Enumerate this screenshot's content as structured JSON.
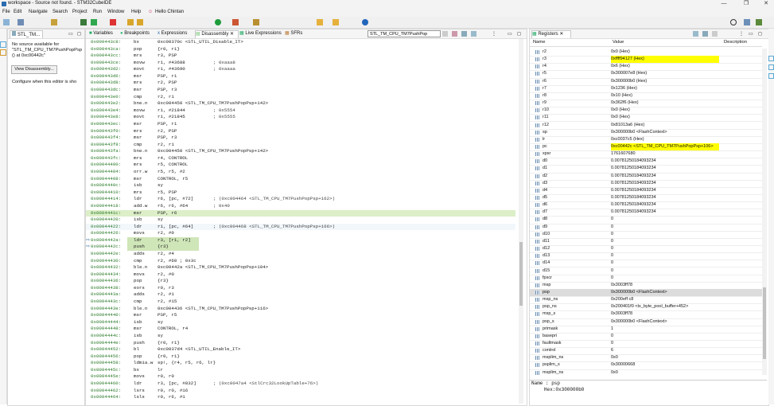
{
  "window": {
    "title": "workspace - Source not found. - STM32CubeIDE",
    "controls": [
      "—",
      "❐",
      "✕"
    ]
  },
  "menu": [
    "File",
    "Edit",
    "Navigate",
    "Search",
    "Project",
    "Run",
    "Window",
    "Help"
  ],
  "greeting": "Hello Chintan",
  "editor": {
    "tab": "STL_TM...",
    "message": [
      "No source available for",
      "\"STL_TM_CPU_TM7PushPopPsp",
      "() at 0xc00442c\""
    ],
    "button": "View Disassembly...",
    "hint": "Configure when this editor is sho"
  },
  "center_tabs": [
    "Variables",
    "Breakpoints",
    "Expressions",
    "Disassembly",
    "Live Expressions",
    "SFRs"
  ],
  "address_field": "STL_TM_CPU_TM7PushPop",
  "disassembly": [
    [
      "0x000443c8:",
      "bx",
      "0xc00370c <STL_UTIL_Disable_IT>",
      ""
    ],
    [
      "0x000443ca:",
      "pop",
      "{r0, r1}",
      ""
    ],
    [
      "0x000443cc:",
      "mrs",
      "r3, PSP",
      ""
    ],
    [
      "0x000443ce:",
      "movw",
      "r1, #43688",
      "; 0xaaa8"
    ],
    [
      "0x000443d2:",
      "movt",
      "r1, #43690",
      "; 0xaaaa"
    ],
    [
      "0x000443d6:",
      "msr",
      "PSP, r1",
      ""
    ],
    [
      "0x000443d8:",
      "mrs",
      "r2, PSP",
      ""
    ],
    [
      "0x000443dc:",
      "msr",
      "PSP, r3",
      ""
    ],
    [
      "0x000443e0:",
      "cmp",
      "r2, r1",
      ""
    ],
    [
      "0x000443e2:",
      "bne.n",
      "0xc004450 <STL_TM_CPU_TM7PushPopPsp+142>",
      ""
    ],
    [
      "0x000443e4:",
      "movw",
      "r1, #21844",
      "; 0x5554"
    ],
    [
      "0x000443e8:",
      "movt",
      "r1, #21845",
      "; 0x5555"
    ],
    [
      "0x000443ec:",
      "msr",
      "PSP, r1",
      ""
    ],
    [
      "0x000443f0:",
      "mrs",
      "r2, PSP",
      ""
    ],
    [
      "0x000443f4:",
      "msr",
      "PSP, r3",
      ""
    ],
    [
      "0x000443f8:",
      "cmp",
      "r2, r1",
      ""
    ],
    [
      "0x000443fa:",
      "bne.n",
      "0xc004450 <STL_TM_CPU_TM7PushPopPsp+142>",
      ""
    ],
    [
      "0x000443fc:",
      "mrs",
      "r4, CONTROL",
      ""
    ],
    [
      "0x00044400:",
      "mrs",
      "r5, CONTROL",
      ""
    ],
    [
      "0x00044404:",
      "orr.w",
      "r5, r5, #2",
      ""
    ],
    [
      "0x00044408:",
      "msr",
      "CONTROL, r5",
      ""
    ],
    [
      "0x0004440c:",
      "isb",
      "sy",
      ""
    ],
    [
      "0x00044410:",
      "mrs",
      "r5, PSP",
      ""
    ],
    [
      "0x00044414:",
      "ldr",
      "r6, [pc, #72]",
      "; (0xc004464 <STL_TM_CPU_TM7PushPopPsp+162>)"
    ],
    [
      "0x00044418:",
      "add.w",
      "r6, r6, #64",
      "; 0x40"
    ],
    [
      "0x0004441c:",
      "msr",
      "PSP, r6",
      ""
    ],
    [
      "0x00044420:",
      "isb",
      "sy",
      ""
    ],
    [
      "0x00044422:",
      "ldr",
      "r1, [pc, #64]",
      "; (0xc004468 <STL_TM_CPU_TM7PushPopPsp+166>)"
    ],
    [
      "0x00044426:",
      "movs",
      "r2, #0",
      ""
    ],
    [
      "0x0004442a:",
      "ldr",
      "r3, [r1, r2]",
      ""
    ],
    [
      "0x0004442c:",
      "push",
      "{r3}",
      ""
    ],
    [
      "0x0004442e:",
      "adds",
      "r2, #4",
      ""
    ],
    [
      "0x00044430:",
      "cmp",
      "r2, #60 ; 0x3c",
      ""
    ],
    [
      "0x00044432:",
      "ble.n",
      "0xc00442a <STL_TM_CPU_TM7PushPopPsp+104>",
      ""
    ],
    [
      "0x00044434:",
      "movs",
      "r2, #0",
      ""
    ],
    [
      "0x00044436:",
      "pop",
      "{r3}",
      ""
    ],
    [
      "0x00044438:",
      "eors",
      "r0, r3",
      ""
    ],
    [
      "0x0004443a:",
      "adds",
      "r2, #1",
      ""
    ],
    [
      "0x0004443c:",
      "cmp",
      "r2, #15",
      ""
    ],
    [
      "0x0004443e:",
      "ble.n",
      "0xc004436 <STL_TM_CPU_TM7PushPopPsp+116>",
      ""
    ],
    [
      "0x00044440:",
      "msr",
      "PSP, r5",
      ""
    ],
    [
      "0x00044444:",
      "isb",
      "sy",
      ""
    ],
    [
      "0x00044448:",
      "msr",
      "CONTROL, r4",
      ""
    ],
    [
      "0x0004444c:",
      "isb",
      "sy",
      ""
    ],
    [
      "0x0004444e:",
      "push",
      "{r0, r1}",
      ""
    ],
    [
      "0x00044452:",
      "bl",
      "0xc0037d4 <STL_UTIL_Enable_IT>",
      ""
    ],
    [
      "0x00044456:",
      "pop",
      "{r0, r1}",
      ""
    ],
    [
      "0x00044458:",
      "ldmia.w",
      "sp!, {r4, r5, r6, lr}",
      ""
    ],
    [
      "0x0004445c:",
      "bx",
      "lr",
      ""
    ],
    [
      "0x0004445e:",
      "movs",
      "r0, r0",
      ""
    ],
    [
      "0x00044460:",
      "ldr",
      "r3, [pc, #832]",
      "; (0xc0047a4 <StlCrc32LookUpTable+76>)"
    ],
    [
      "0x00044462:",
      "lsrs",
      "r0, r0, #16",
      ""
    ],
    [
      "0x00044464:",
      "lsls",
      "r0, r6, #1",
      ""
    ]
  ],
  "registers_tab": "Registers",
  "registers_columns": [
    "Name",
    "Value",
    "Description"
  ],
  "registers": [
    [
      "r2",
      "0x0 (Hex)"
    ],
    [
      "r3",
      "0xffff94127 (Hex)"
    ],
    [
      "r4",
      "0x6 (Hex)"
    ],
    [
      "r5",
      "0x300007e8 (Hex)"
    ],
    [
      "r6",
      "0x300000b0 (Hex)"
    ],
    [
      "r7",
      "0x1236 (Hex)"
    ],
    [
      "r8",
      "0x10 (Hex)"
    ],
    [
      "r9",
      "0x362f6 (Hex)"
    ],
    [
      "r10",
      "0x0 (Hex)"
    ],
    [
      "r11",
      "0x0 (Hex)"
    ],
    [
      "r12",
      "0x81013a6 (Hex)"
    ],
    [
      "sp",
      "0x300000b0 <FlashContext>"
    ],
    [
      "lr",
      "0xc0037c5 (Hex)"
    ],
    [
      "pc",
      "0xc00442c <STL_TM_CPU_TM7PushPopPsp+106>"
    ],
    [
      "xpsr",
      "1761607680"
    ],
    [
      "d0",
      "0.00781250184093234"
    ],
    [
      "d1",
      "0.00781250184093234"
    ],
    [
      "d2",
      "0.00781250184093234"
    ],
    [
      "d3",
      "0.00781250184093234"
    ],
    [
      "d4",
      "0.00781250184093234"
    ],
    [
      "d5",
      "0.00781250184093234"
    ],
    [
      "d6",
      "0.00781250184093234"
    ],
    [
      "d7",
      "0.00781250184093234"
    ],
    [
      "d8",
      "0"
    ],
    [
      "d9",
      "0"
    ],
    [
      "d10",
      "0"
    ],
    [
      "d11",
      "0"
    ],
    [
      "d12",
      "0"
    ],
    [
      "d13",
      "0"
    ],
    [
      "d14",
      "0"
    ],
    [
      "d15",
      "0"
    ],
    [
      "fpscr",
      "0"
    ],
    [
      "msp",
      "0x3003ff78"
    ],
    [
      "psp",
      "0x300000b0 <FlashContext>"
    ],
    [
      "msp_ns",
      "0x200eff c8"
    ],
    [
      "psp_ns",
      "0x200401f0 <tx_byte_pool_buffer+452>"
    ],
    [
      "msp_s",
      "0x3003ff78"
    ],
    [
      "psp_s",
      "0x300000b0 <FlashContext>"
    ],
    [
      "primask",
      "1"
    ],
    [
      "basepri",
      "0"
    ],
    [
      "faultmask",
      "0"
    ],
    [
      "control",
      "6"
    ],
    [
      "msplim_ns",
      "0x0"
    ],
    [
      "psplim_s",
      "0x30000668"
    ],
    [
      "msplim_ns",
      "0x0"
    ]
  ],
  "details": [
    "Name : psp",
    "Hex:0x300000b0"
  ],
  "colors": {
    "highlight": "#ffff00",
    "current_line": "#d9ecc4",
    "address": "#2a7a2a"
  }
}
